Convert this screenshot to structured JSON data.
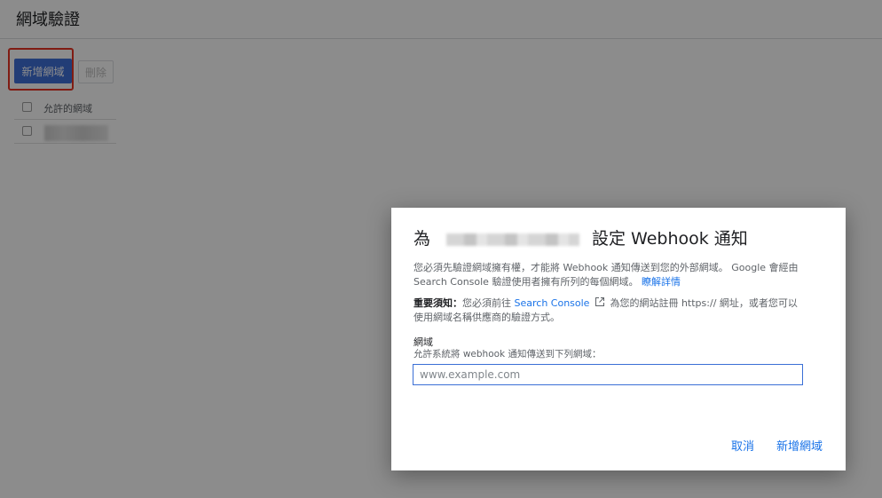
{
  "page": {
    "title": "網域驗證",
    "add_button": "新增網域",
    "delete_button": "刪除",
    "table": {
      "header": "允許的網域"
    }
  },
  "dialog": {
    "title_prefix": "為",
    "title_suffix": "設定 Webhook 通知",
    "para1_text": "您必須先驗證網域擁有權，才能將 Webhook 通知傳送到您的外部網域。 Google 會經由 Search Console 驗證使用者擁有所列的每個網域。",
    "para1_link": "瞭解詳情",
    "para2_bold": "重要須知：",
    "para2_text_a": "您必須前往",
    "para2_link": "Search Console",
    "para2_text_b": "為您的網站註冊 https:// 網址，或者您可以使用網域名稱供應商的驗證方式。",
    "field_label": "網域",
    "field_help": "允許系統將 webhook 通知傳送到下列網域：",
    "input_value": "",
    "input_placeholder": "www.example.com",
    "cancel_button": "取消",
    "confirm_button": "新增網域"
  },
  "colors": {
    "primary_button": "#3f6fd8",
    "link": "#1a73e8",
    "highlight_frame": "#ea3323"
  },
  "icons": {
    "external_link": "external-link-icon"
  }
}
